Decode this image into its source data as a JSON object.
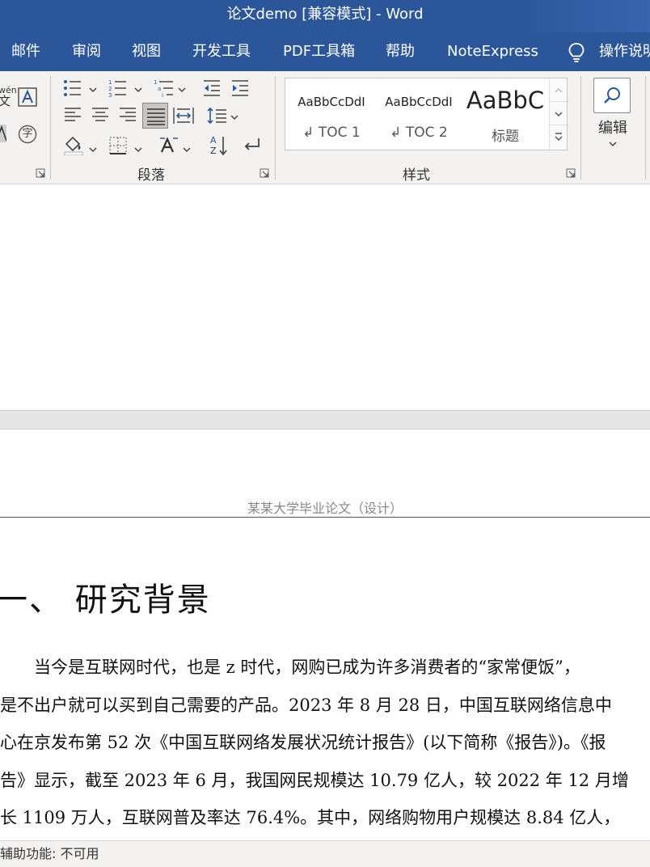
{
  "window": {
    "title": "论文demo [兼容模式]  -  Word"
  },
  "tabs": [
    "邮件",
    "审阅",
    "视图",
    "开发工具",
    "PDF工具箱",
    "帮助",
    "NoteExpress"
  ],
  "tell_me": {
    "label": "操作说明",
    "icon": "lightbulb-icon"
  },
  "ribbon": {
    "font_group": {
      "phonetic_top": "wén",
      "phonetic_bottom": "文",
      "enclose_char": "字"
    },
    "paragraph_group": {
      "label": "段落"
    },
    "styles_group": {
      "label": "样式",
      "styles": [
        {
          "sample": "AaBbCcDdI",
          "name": "↲ TOC 1"
        },
        {
          "sample": "AaBbCcDdI",
          "name": "↲ TOC 2"
        },
        {
          "sample": "AaBbC",
          "name": "标题"
        }
      ]
    },
    "editing_group": {
      "label": "编辑",
      "icon": "search-icon"
    }
  },
  "document": {
    "header_text": "某某大学毕业论文（设计）",
    "heading": "一、 研究背景",
    "paragraph_lines": [
      "　　当今是互联网时代，也是 z 时代，网购已成为许多消费者的“家常便饭”，",
      "是不出户就可以买到自己需要的产品。2023 年 8 月 28 日，中国互联网络信息中",
      "心在京发布第 52 次《中国互联网络发展状况统计报告》(以下简称《报告》)。《报",
      "告》显示，截至 2023 年 6 月，我国网民规模达 10.79 亿人，较 2022 年 12 月增",
      "长 1109 万人，互联网普及率达 76.4%。其中，网络购物用户规模达 8.84 亿人，"
    ]
  },
  "status_bar": {
    "accessibility": "辅助功能: 不可用"
  },
  "colors": {
    "accent": "#2b579a",
    "ribbon_bg": "#f3f2f1"
  }
}
